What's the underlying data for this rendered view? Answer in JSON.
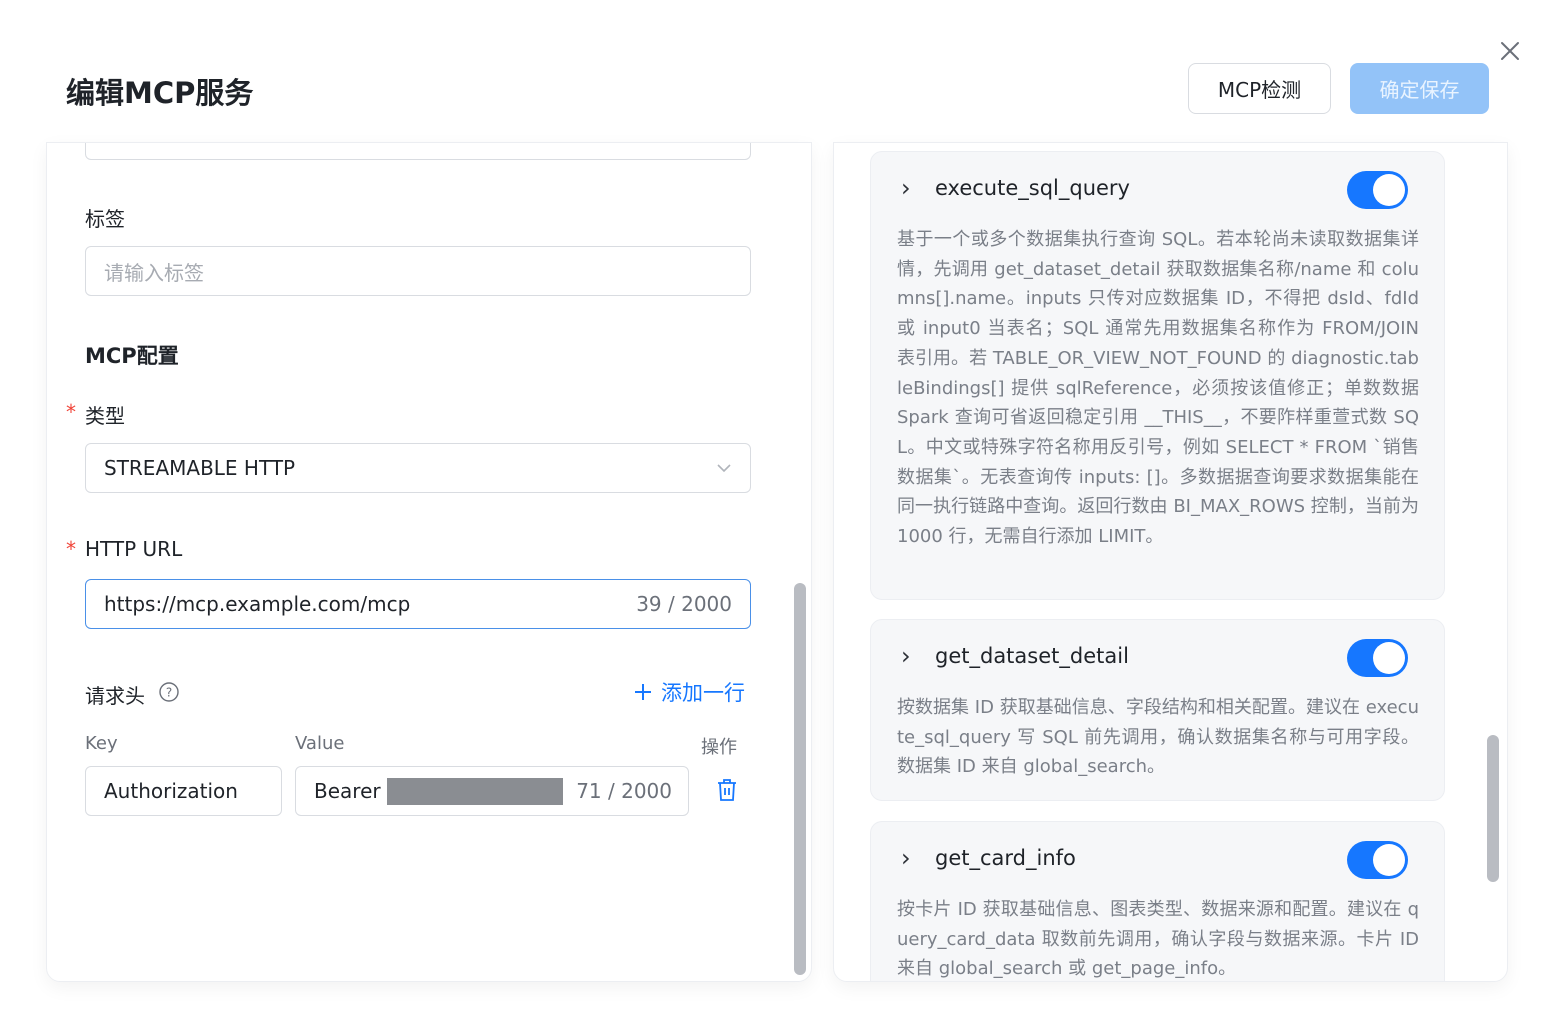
{
  "header": {
    "title": "编辑MCP服务",
    "check_button": "MCP检测",
    "save_button": "确定保存"
  },
  "form": {
    "tags_label": "标签",
    "tags_placeholder": "请输入标签",
    "section_title": "MCP配置",
    "type_label": "类型",
    "type_value": "STREAMABLE HTTP",
    "url_label": "HTTP URL",
    "url_value": "https://mcp.example.com/mcp",
    "url_counter": "39 / 2000",
    "headers_label": "请求头",
    "add_row": "添加一行",
    "columns": {
      "key": "Key",
      "value": "Value",
      "action": "操作"
    },
    "header_row": {
      "key": "Authorization",
      "value_prefix": "Bearer",
      "counter": "71 / 2000"
    }
  },
  "tools": [
    {
      "name": "execute_sql_query",
      "enabled": true,
      "description": "基于一个或多个数据集执行查询 SQL。若本轮尚未读取数据集详情，先调用 get_dataset_detail 获取数据集名称/name 和 columns[].name。inputs 只传对应数据集 ID，不得把 dsId、fdId 或 input0 当表名；SQL 通常先用数据集名称作为 FROM/JOIN 表引用。若 TABLE_OR_VIEW_NOT_FOUND 的 diagnostic.tableBindings[] 提供 sqlReference，必须按该值修正；单数数据 Spark 查询可省返回稳定引用 __THIS__，不要阼样重萱式数 SQL。中文或特殊字符名称用反引号，例如 SELECT * FROM `销售数据集`。无表查询传 inputs: []。多数据据查询要求数据集能在同一执行链路中查询。返回行数由 BI_MAX_ROWS 控制，当前为 1000 行，无需自行添加 LIMIT。"
    },
    {
      "name": "get_dataset_detail",
      "enabled": true,
      "description": "按数据集 ID 获取基础信息、字段结构和相关配置。建议在 execute_sql_query 写 SQL 前先调用，确认数据集名称与可用字段。数据集 ID 来自 global_search。"
    },
    {
      "name": "get_card_info",
      "enabled": true,
      "description": "按卡片 ID 获取基础信息、图表类型、数据来源和配置。建议在 query_card_data 取数前先调用，确认字段与数据来源。卡片 ID 来自 global_search 或 get_page_info。"
    }
  ],
  "colors": {
    "accent": "#1677ff",
    "required": "#f04438",
    "save_disabled": "#93c3f8"
  }
}
